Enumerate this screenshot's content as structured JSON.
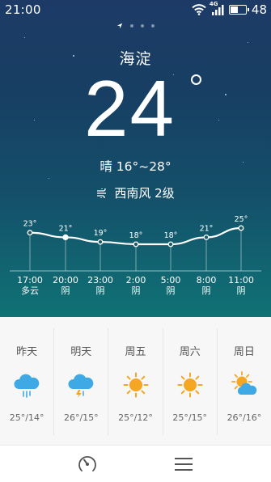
{
  "status_bar": {
    "time": "21:00",
    "network": "4G",
    "battery": "48",
    "battery_level": 0.48
  },
  "pager": {
    "count": 4,
    "active": 0
  },
  "current": {
    "city": "海淀",
    "temperature": "24",
    "condition": "晴 16°~28°",
    "wind": "西南风 2级"
  },
  "hourly": [
    {
      "temp": "23°",
      "time": "17:00",
      "cond": "多云",
      "value": 23
    },
    {
      "temp": "21°",
      "time": "20:00",
      "cond": "阴",
      "value": 21
    },
    {
      "temp": "19°",
      "time": "23:00",
      "cond": "阴",
      "value": 19
    },
    {
      "temp": "18°",
      "time": "2:00",
      "cond": "阴",
      "value": 18
    },
    {
      "temp": "18°",
      "time": "5:00",
      "cond": "阴",
      "value": 18
    },
    {
      "temp": "21°",
      "time": "8:00",
      "cond": "阴",
      "value": 21
    },
    {
      "temp": "25°",
      "time": "11:00",
      "cond": "阴",
      "value": 25
    }
  ],
  "daily": [
    {
      "day": "昨天",
      "icon": "rain-cloud-icon",
      "range": "25°/14°"
    },
    {
      "day": "明天",
      "icon": "thunder-cloud-icon",
      "range": "26°/15°"
    },
    {
      "day": "周五",
      "icon": "sun-icon",
      "range": "25°/12°"
    },
    {
      "day": "周六",
      "icon": "sun-icon",
      "range": "25°/15°"
    },
    {
      "day": "周日",
      "icon": "partly-cloudy-icon",
      "range": "26°/16°"
    }
  ],
  "bottom_nav": {
    "left_icon": "gauge-icon",
    "right_icon": "menu-icon"
  },
  "colors": {
    "sun": "#f5a623",
    "cloud": "#3fa9e5",
    "rain": "#3fa9e5",
    "bolt": "#f5a623"
  }
}
